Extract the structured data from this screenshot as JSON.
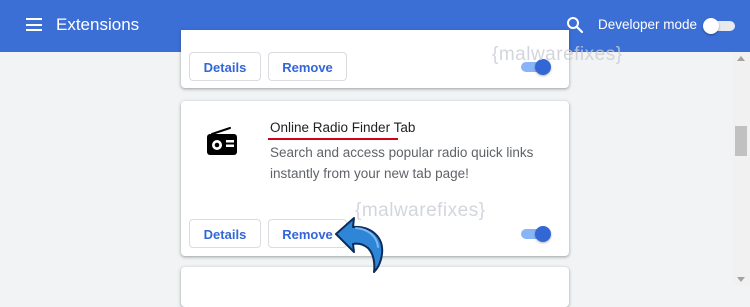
{
  "header": {
    "title": "Extensions",
    "dev_mode_label": "Developer mode",
    "dev_mode_enabled": false,
    "icons": {
      "menu": "hamburger-menu-icon",
      "search": "search-icon"
    }
  },
  "cards": {
    "top": {
      "details_label": "Details",
      "remove_label": "Remove",
      "enabled": true
    },
    "main": {
      "name": "Online Radio Finder Tab",
      "description": "Search and access popular radio quick links instantly from your new tab page!",
      "details_label": "Details",
      "remove_label": "Remove",
      "enabled": true,
      "icon": "radio-icon"
    }
  },
  "watermark": {
    "text": "{malwarefixes}"
  },
  "colors": {
    "header_bg": "#3b6fd6",
    "accent": "#3367d6",
    "underline": "#d0021b",
    "arrow": "#2f86d6"
  }
}
